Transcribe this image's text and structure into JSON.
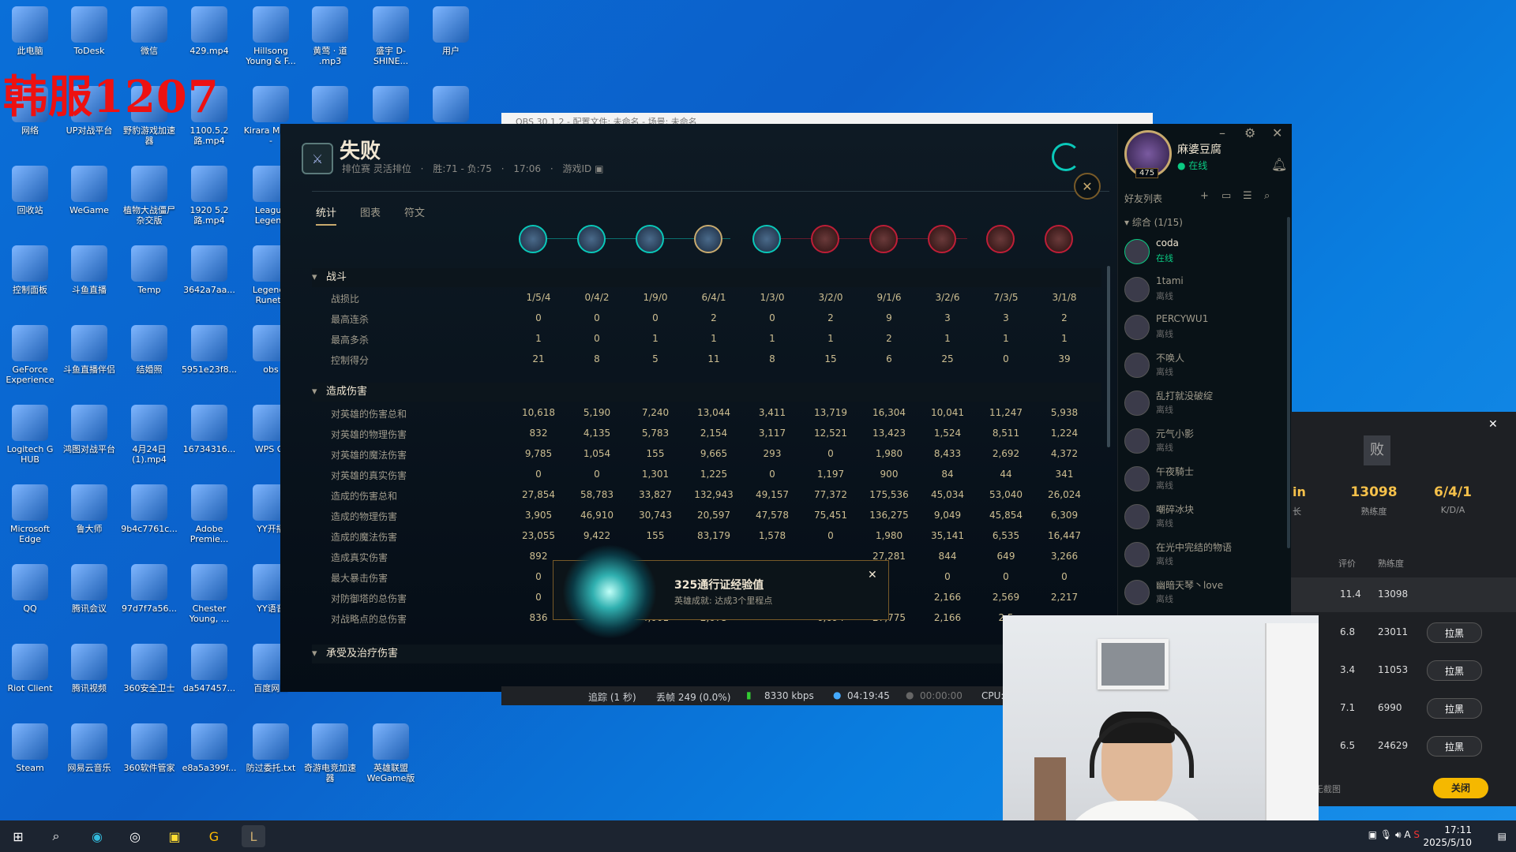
{
  "overlay_text": "韩服1207",
  "desktop_icons": [
    {
      "label": "此电脑",
      "icon": "computer-icon"
    },
    {
      "label": "ToDesk",
      "icon": "todesk-icon"
    },
    {
      "label": "微信",
      "icon": "wechat-icon"
    },
    {
      "label": "429.mp4",
      "icon": "video-icon"
    },
    {
      "label": "Hillsong Young & F...",
      "icon": "music-icon"
    },
    {
      "label": "黄莺 · 道 .mp3",
      "icon": "music-icon"
    },
    {
      "label": "盛宇 D-SHINE...",
      "icon": "mp3-icon"
    },
    {
      "label": "用户",
      "icon": "folder-icon"
    },
    {
      "label": "网络",
      "icon": "network-icon"
    },
    {
      "label": "UP对战平台",
      "icon": "app-icon"
    },
    {
      "label": "野豹游戏加速器",
      "icon": "app-icon"
    },
    {
      "label": "1100.5.2路.mp4",
      "icon": "video-icon"
    },
    {
      "label": "Kirara Magic -",
      "icon": "mp3-icon"
    },
    {
      "label": "",
      "icon": "capcut-icon"
    },
    {
      "label": "",
      "icon": "kgm-icon"
    },
    {
      "label": "",
      "icon": "game-icon"
    },
    {
      "label": "回收站",
      "icon": "recycle-bin-icon"
    },
    {
      "label": "WeGame",
      "icon": "wegame-icon"
    },
    {
      "label": "植物大战僵尸杂交版",
      "icon": "game-icon"
    },
    {
      "label": "1920 5.2路.mp4",
      "icon": "video-icon"
    },
    {
      "label": "League Legend",
      "icon": "lol-icon"
    },
    {
      "label": "控制面板",
      "icon": "control-panel-icon"
    },
    {
      "label": "斗鱼直播",
      "icon": "douyu-icon"
    },
    {
      "label": "Temp",
      "icon": "folder-icon"
    },
    {
      "label": "3642a7aa...",
      "icon": "file-icon"
    },
    {
      "label": "Legends Runete",
      "icon": "lol-icon"
    },
    {
      "label": "GeForce Experience",
      "icon": "nvidia-icon"
    },
    {
      "label": "斗鱼直播伴侣",
      "icon": "douyu-icon"
    },
    {
      "label": "结婚照",
      "icon": "folder-icon"
    },
    {
      "label": "5951e23f8...",
      "icon": "image-icon"
    },
    {
      "label": "obs",
      "icon": "obs-icon"
    },
    {
      "label": "Logitech G HUB",
      "icon": "logitech-icon"
    },
    {
      "label": "鸿图对战平台",
      "icon": "app-icon"
    },
    {
      "label": "4月24日(1).mp4",
      "icon": "video-icon"
    },
    {
      "label": "16734316...",
      "icon": "video-icon"
    },
    {
      "label": "WPS Of",
      "icon": "wps-icon"
    },
    {
      "label": "Microsoft Edge",
      "icon": "edge-icon"
    },
    {
      "label": "鲁大师",
      "icon": "app-icon"
    },
    {
      "label": "9b4c7761c...",
      "icon": "video-icon"
    },
    {
      "label": "Adobe Premie...",
      "icon": "premiere-icon"
    },
    {
      "label": "YY开播",
      "icon": "yy-icon"
    },
    {
      "label": "QQ",
      "icon": "qq-icon"
    },
    {
      "label": "腾讯会议",
      "icon": "meeting-icon"
    },
    {
      "label": "97d7f7a56...",
      "icon": "image-icon"
    },
    {
      "label": "Chester Young, ...",
      "icon": "flac-icon"
    },
    {
      "label": "YY语音",
      "icon": "yy-icon"
    },
    {
      "label": "Riot Client",
      "icon": "riot-icon"
    },
    {
      "label": "腾讯视频",
      "icon": "video-app-icon"
    },
    {
      "label": "360安全卫士",
      "icon": "360-icon"
    },
    {
      "label": "da547457...",
      "icon": "file-icon"
    },
    {
      "label": "百度网...",
      "icon": "baidu-icon"
    },
    {
      "label": "Steam",
      "icon": "steam-icon"
    },
    {
      "label": "网易云音乐",
      "icon": "netease-icon"
    },
    {
      "label": "360软件管家",
      "icon": "360-icon"
    },
    {
      "label": "e8a5a399f...",
      "icon": "file-icon"
    },
    {
      "label": "防过委托.txt",
      "icon": "txt-icon"
    },
    {
      "label": "奇游电竞加速器",
      "icon": "app-icon"
    },
    {
      "label": "英雄联盟 WeGame版",
      "icon": "lol-icon"
    }
  ],
  "match": {
    "result": "失败",
    "queue": "排位赛 灵活排位",
    "record": "胜:71 - 负:75",
    "duration": "17:06",
    "game_id_label": "游戏ID",
    "tabs": [
      "统计",
      "图表",
      "符文"
    ]
  },
  "sections": {
    "combat": "战斗",
    "damage": "造成伤害",
    "taken": "承受及治疗伤害"
  },
  "combat_rows": [
    {
      "label": "战损比",
      "values": [
        "1/5/4",
        "0/4/2",
        "1/9/0",
        "6/4/1",
        "1/3/0",
        "3/2/0",
        "9/1/6",
        "3/2/6",
        "7/3/5",
        "3/1/8"
      ]
    },
    {
      "label": "最高连杀",
      "values": [
        "0",
        "0",
        "0",
        "2",
        "0",
        "2",
        "9",
        "3",
        "3",
        "2"
      ]
    },
    {
      "label": "最高多杀",
      "values": [
        "1",
        "0",
        "1",
        "1",
        "1",
        "1",
        "2",
        "1",
        "1",
        "1"
      ]
    },
    {
      "label": "控制得分",
      "values": [
        "21",
        "8",
        "5",
        "11",
        "8",
        "15",
        "6",
        "25",
        "0",
        "39"
      ]
    }
  ],
  "damage_rows": [
    {
      "label": "对英雄的伤害总和",
      "values": [
        "10,618",
        "5,190",
        "7,240",
        "13,044",
        "3,411",
        "13,719",
        "16,304",
        "10,041",
        "11,247",
        "5,938"
      ]
    },
    {
      "label": "对英雄的物理伤害",
      "values": [
        "832",
        "4,135",
        "5,783",
        "2,154",
        "3,117",
        "12,521",
        "13,423",
        "1,524",
        "8,511",
        "1,224"
      ]
    },
    {
      "label": "对英雄的魔法伤害",
      "values": [
        "9,785",
        "1,054",
        "155",
        "9,665",
        "293",
        "0",
        "1,980",
        "8,433",
        "2,692",
        "4,372"
      ]
    },
    {
      "label": "对英雄的真实伤害",
      "values": [
        "0",
        "0",
        "1,301",
        "1,225",
        "0",
        "1,197",
        "900",
        "84",
        "44",
        "341"
      ]
    },
    {
      "label": "造成的伤害总和",
      "values": [
        "27,854",
        "58,783",
        "33,827",
        "132,943",
        "49,157",
        "77,372",
        "175,536",
        "45,034",
        "53,040",
        "26,024"
      ]
    },
    {
      "label": "造成的物理伤害",
      "values": [
        "3,905",
        "46,910",
        "30,743",
        "20,597",
        "47,578",
        "75,451",
        "136,275",
        "9,049",
        "45,854",
        "6,309"
      ]
    },
    {
      "label": "造成的魔法伤害",
      "values": [
        "23,055",
        "9,422",
        "155",
        "83,179",
        "1,578",
        "0",
        "1,980",
        "35,141",
        "6,535",
        "16,447"
      ]
    },
    {
      "label": "造成真实伤害",
      "values": [
        "892",
        "",
        "",
        "",
        "",
        "",
        "27,281",
        "844",
        "649",
        "3,266"
      ]
    },
    {
      "label": "最大暴击伤害",
      "values": [
        "0",
        "",
        "",
        "",
        "",
        "",
        "",
        "0",
        "0",
        "0"
      ]
    },
    {
      "label": "对防御塔的总伤害",
      "values": [
        "0",
        "",
        "",
        "",
        "",
        "",
        "",
        "2,166",
        "2,569",
        "2,217"
      ]
    },
    {
      "label": "对战略点的总伤害",
      "values": [
        "836",
        "",
        "4,001",
        "2,075",
        "",
        "6,694",
        "27,775",
        "2,166",
        "2,5",
        ""
      ]
    }
  ],
  "notification": {
    "title": "325通行证经验值",
    "subtitle": "英雄成就: 达成3个里程点"
  },
  "profile": {
    "name": "麻婆豆腐",
    "status": "在线",
    "level": "475"
  },
  "friends_header": "好友列表",
  "friends_group": "综合 (1/15)",
  "friends": [
    {
      "name": "coda",
      "status": "在线",
      "online": true
    },
    {
      "name": "1tami",
      "status": "离线",
      "online": false
    },
    {
      "name": "PERCYWU1",
      "status": "离线",
      "online": false
    },
    {
      "name": "不唤人",
      "status": "离线",
      "online": false
    },
    {
      "name": "乱打就没破绽",
      "status": "离线",
      "online": false
    },
    {
      "name": "元气小影",
      "status": "离线",
      "online": false
    },
    {
      "name": "午夜騎士",
      "status": "离线",
      "online": false
    },
    {
      "name": "嘲碎冰块",
      "status": "离线",
      "online": false
    },
    {
      "name": "在光中完结的物语",
      "status": "离线",
      "online": false
    },
    {
      "name": "幽暗天琴丶love",
      "status": "离线",
      "online": false
    }
  ],
  "side_panel": {
    "badge": "败",
    "stat1_value": "13098",
    "stat1_label": "熟练度",
    "stat2_value": "6/4/1",
    "stat2_label": "K/D/A",
    "partial_left": "in",
    "partial_left2": "长",
    "col_rating": "评价",
    "col_mastery": "熟练度",
    "rows": [
      {
        "rating": "11.4",
        "mastery": "13098",
        "btn": ""
      },
      {
        "rating": "6.8",
        "mastery": "23011",
        "btn": "拉黑"
      },
      {
        "rating": "3.4",
        "mastery": "11053",
        "btn": "拉黑"
      },
      {
        "rating": "7.1",
        "mastery": "6990",
        "btn": "拉黑"
      },
      {
        "rating": "6.5",
        "mastery": "24629",
        "btn": "拉黑"
      }
    ],
    "screenshot_label": "无截图",
    "close_btn": "关闭"
  },
  "rec_bar": {
    "frames": "追踪 (1 秒)",
    "dropped": "丢帧 249 (0.0%)",
    "bitrate": "8330 kbps",
    "time1": "04:19:45",
    "time2": "00:00:00",
    "cpu": "CPU:"
  },
  "bg_window_title": "OBS 30.1.2 - 配置文件: 未命名 - 场景: 未命名",
  "tray": {
    "time": "17:11",
    "date": "2025/5/10",
    "ime": "A"
  },
  "colors": {
    "accent": "#c8aa6e",
    "blue_team": "#0ac8b9",
    "red_team": "#be1e37",
    "online": "#0acb83"
  }
}
